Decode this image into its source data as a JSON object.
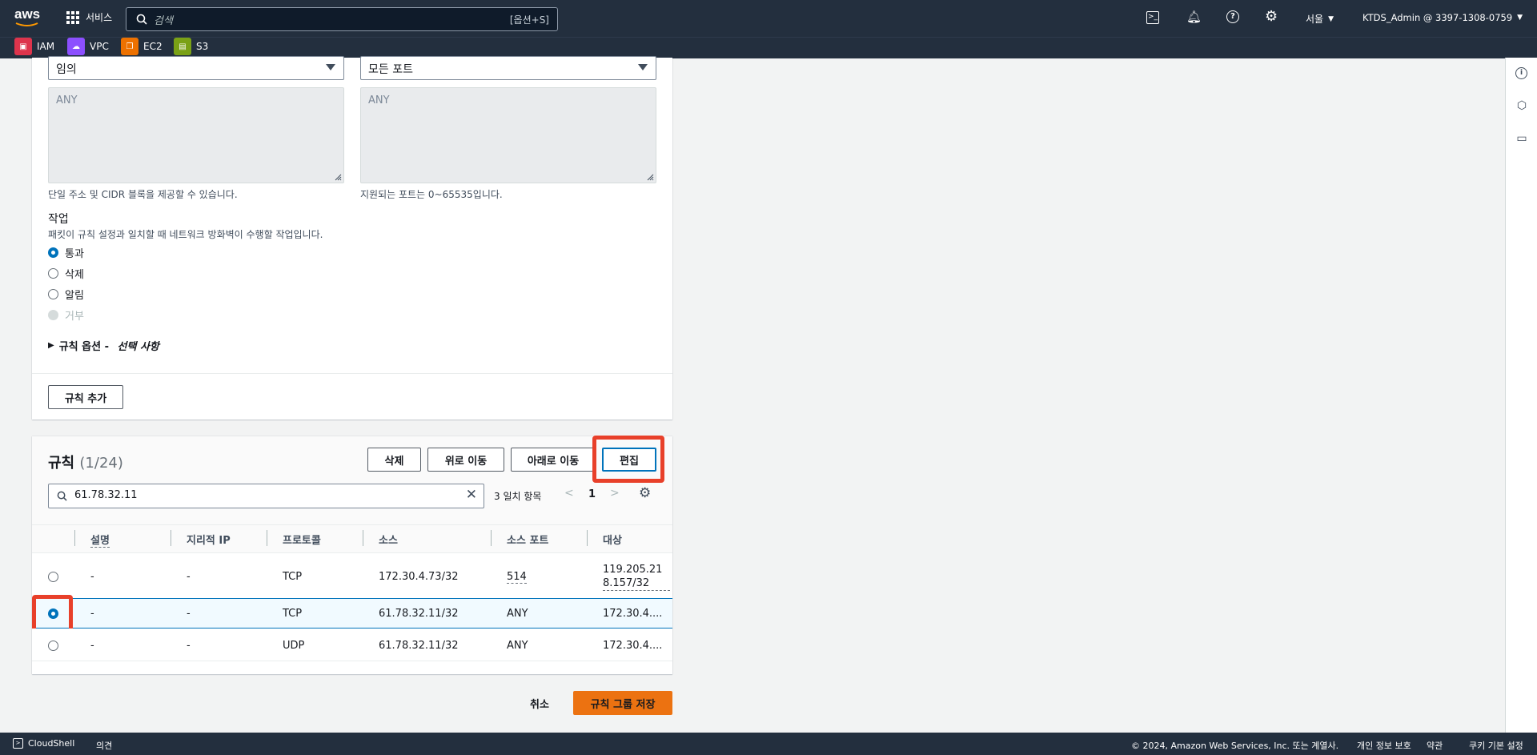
{
  "topnav": {
    "logo": "aws",
    "services_label": "서비스",
    "search_placeholder": "검색",
    "search_shortcut": "[옵션+S]",
    "region": "서울",
    "account": "KTDS_Admin @ 3397-1308-0759"
  },
  "favorites": [
    {
      "label": "IAM",
      "color": "#dd344c"
    },
    {
      "label": "VPC",
      "color": "#8c4fff"
    },
    {
      "label": "EC2",
      "color": "#ed7100"
    },
    {
      "label": "S3",
      "color": "#7aa116"
    }
  ],
  "form": {
    "source_select": "임의",
    "port_select": "모든 포트",
    "source_placeholder": "ANY",
    "port_placeholder": "ANY",
    "source_hint": "단일 주소 및 CIDR 블록을 제공할 수 있습니다.",
    "port_hint": "지원되는 포트는 0~65535입니다.",
    "action_label": "작업",
    "action_desc": "패킷이 규칙 설정과 일치할 때 네트워크 방화벽이 수행할 작업입니다.",
    "actions": [
      {
        "label": "통과",
        "state": "selected"
      },
      {
        "label": "삭제",
        "state": "normal"
      },
      {
        "label": "알림",
        "state": "normal"
      },
      {
        "label": "거부",
        "state": "disabled"
      }
    ],
    "rule_options_label": "규칙 옵션 - ",
    "rule_options_optional": "선택 사항",
    "add_rule_button": "규칙 추가"
  },
  "rules": {
    "title": "규칙",
    "count": "(1/24)",
    "delete_button": "삭제",
    "move_up_button": "위로 이동",
    "move_down_button": "아래로 이동",
    "edit_button": "편집",
    "filter_value": "61.78.32.11",
    "match_count": "3 일치 항목",
    "page": "1",
    "columns": [
      "설명",
      "지리적 IP",
      "프로토콜",
      "소스",
      "소스 포트",
      "대상"
    ],
    "rows": [
      {
        "desc": "-",
        "geo": "-",
        "protocol": "TCP",
        "source": "172.30.4.73/32",
        "source_port": "514",
        "dest_line1": "119.205.21",
        "dest_line2": "8.157/32",
        "selected": false
      },
      {
        "desc": "-",
        "geo": "-",
        "protocol": "TCP",
        "source": "61.78.32.11/32",
        "source_port": "ANY",
        "dest_line1": "172.30.4....",
        "dest_line2": "",
        "selected": true
      },
      {
        "desc": "-",
        "geo": "-",
        "protocol": "UDP",
        "source": "61.78.32.11/32",
        "source_port": "ANY",
        "dest_line1": "172.30.4....",
        "dest_line2": "",
        "selected": false
      }
    ]
  },
  "actions_bar": {
    "cancel": "취소",
    "save": "규칙 그룹 저장"
  },
  "footer": {
    "cloudshell": "CloudShell",
    "feedback": "의견",
    "copyright": "© 2024, Amazon Web Services, Inc. 또는 계열사.",
    "privacy": "개인 정보 보호",
    "terms": "약관",
    "cookies": "쿠키 기본 설정"
  }
}
